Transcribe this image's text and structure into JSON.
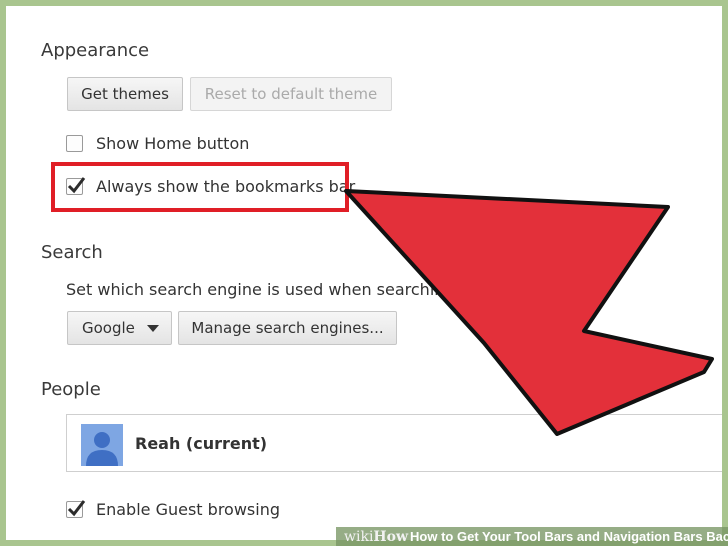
{
  "appearance": {
    "title": "Appearance",
    "get_themes_label": "Get themes",
    "reset_theme_label": "Reset to default theme",
    "show_home_label": "Show Home button",
    "show_home_checked": false,
    "bookmarks_bar_label": "Always show the bookmarks bar",
    "bookmarks_bar_checked": true
  },
  "search": {
    "title": "Search",
    "description": "Set which search engine is used when searching",
    "engine_selected": "Google",
    "manage_label": "Manage search engines..."
  },
  "people": {
    "title": "People",
    "profile_name": "Reah (current)",
    "guest_label": "Enable Guest browsing",
    "guest_checked": true
  },
  "annotation": {
    "highlight_color": "#e01e26",
    "arrow_color": "#e3303a"
  },
  "watermark": {
    "logo": "wikiHow",
    "caption": "How to Get Your Tool Bars and Navigation Bars Back"
  }
}
